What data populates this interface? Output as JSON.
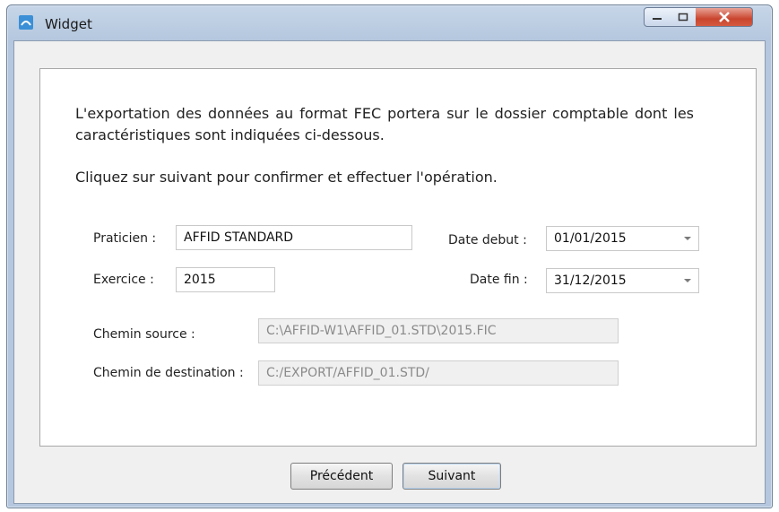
{
  "window": {
    "title": "Widget"
  },
  "intro": {
    "paragraph": "L'exportation des données au format FEC portera sur le dossier comptable dont les caractéristiques sont indiquées ci-dessous.",
    "instruction": "Cliquez sur suivant pour confirmer et effectuer l'opération."
  },
  "form": {
    "praticien_label": "Praticien :",
    "praticien_value": "AFFID STANDARD",
    "exercice_label": "Exercice :",
    "exercice_value": "2015",
    "date_debut_label": "Date debut :",
    "date_debut_value": "01/01/2015",
    "date_fin_label": "Date fin :",
    "date_fin_value": "31/12/2015",
    "chemin_source_label": "Chemin source :",
    "chemin_source_value": "C:\\AFFID-W1\\AFFID_01.STD\\2015.FIC",
    "chemin_dest_label": "Chemin de destination :",
    "chemin_dest_value": "C:/EXPORT/AFFID_01.STD/"
  },
  "buttons": {
    "previous": "Précédent",
    "next": "Suivant"
  },
  "icons": {
    "app": "fec-app-icon",
    "minimize": "minimize-icon",
    "maximize": "maximize-icon",
    "close": "close-icon",
    "dropdown": "chevron-down-icon"
  },
  "colors": {
    "titlebar": "#b4c7de",
    "close_button": "#c9452e",
    "client_bg": "#f0f0f0"
  }
}
